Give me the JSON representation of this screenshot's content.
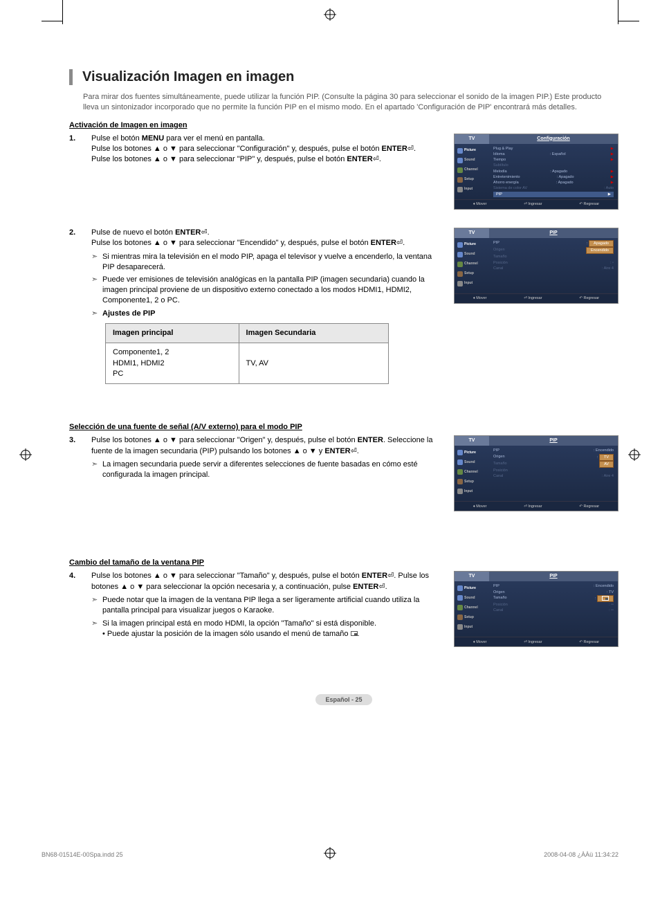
{
  "title": "Visualización Imagen en imagen",
  "intro": "Para mirar dos fuentes simultáneamente, puede utilizar la función PIP. (Consulte la página 30 para seleccionar el sonido de la imagen PIP.) Este producto lleva un sintonizador incorporado que no permite la función PIP en el mismo modo. En el apartado 'Configuración de PIP' encontrará más detalles.",
  "section1": {
    "heading": "Activación de Imagen en imagen",
    "step1a": "Pulse el botón ",
    "step1b": " para ver el menú en pantalla.",
    "menu": "MENU",
    "step1c": "Pulse los botones ▲ o ▼ para seleccionar \"Configuración\" y, después, pulse el botón ",
    "enter": "ENTER",
    "step1d": "Pulse los botones ▲ o ▼ para seleccionar \"PIP\" y, después, pulse el botón ",
    "step2a": "Pulse de nuevo el botón ",
    "step2b": "Pulse los botones ▲ o ▼ para seleccionar \"Encendido\" y, después, pulse el botón ",
    "note1": "Si mientras mira la televisión en el modo PIP, apaga el televisor y vuelve a encenderlo, la ventana PIP desaparecerá.",
    "note2": "Puede ver emisiones de televisión analógicas en la pantalla PIP (imagen secundaria) cuando la imagen principal proviene de un dispositivo externo conectado a los modos HDMI1, HDMI2, Componente1, 2 o PC.",
    "pip_settings": "Ajustes de PIP",
    "th1": "Imagen principal",
    "th2": "Imagen Secundaria",
    "td1a": "Componente1, 2",
    "td1b": "HDMI1, HDMI2",
    "td1c": "PC",
    "td2": "TV, AV"
  },
  "section2": {
    "heading": "Selección de una fuente de señal (A/V externo) para el modo PIP",
    "step3a": "Pulse los botones ▲ o ▼ para seleccionar \"Origen\" y, después, pulse el botón ",
    "step3b": ". Seleccione la fuente de la imagen secundaria (PIP) pulsando los botones ▲ o ▼ y ",
    "note": "La imagen secundaria puede servir a diferentes selecciones de fuente basadas en cómo esté configurada la imagen principal."
  },
  "section3": {
    "heading": "Cambio del tamaño de la ventana PIP",
    "step4a": "Pulse los botones ▲ o ▼ para seleccionar \"Tamaño\" y, después, pulse el botón ",
    "step4b": ". Pulse los botones ▲ o ▼ para seleccionar la opción necesaria y, a continuación, pulse ",
    "note1": "Puede notar que la imagen de la ventana PIP llega a ser ligeramente artificial cuando utiliza la pantalla principal para visualizar juegos o Karaoke.",
    "note2": "Si la imagen principal está en modo HDMI, la opción \"Tamaño\" si está disponible.",
    "note2b": "• Puede ajustar la posición de la imagen sólo usando el menú de tamaño "
  },
  "osd": {
    "tv": "TV",
    "side": {
      "picture": "Picture",
      "sound": "Sound",
      "channel": "Channel",
      "setup": "Setup",
      "input": "Input"
    },
    "footer": {
      "mover": "Mover",
      "ingresar": "Ingresar",
      "regresar": "Regresar"
    },
    "m1": {
      "title": "Configuración",
      "r1": "Plug & Play",
      "r2": "Idioma",
      "r2v": ": Español",
      "r3": "Tiempo",
      "r4": "Subtítulo",
      "r5": "Melodía",
      "r5v": ": Apagado",
      "r6": "Entretenimiento",
      "r6v": ": Apagado",
      "r7": "Ahorro energía",
      "r7v": ": Apagado",
      "r8": "Sistema de color AV",
      "r8v": ": Auto",
      "r9": "PIP"
    },
    "m2": {
      "title": "PIP",
      "r1": "PIP",
      "o1": "Apagado",
      "o2": "Encendido",
      "r2": "Origen",
      "r3": "Tamaño",
      "r4": "Posición",
      "r5": "Canal",
      "r5v": ": Aire    4"
    },
    "m3": {
      "title": "PIP",
      "r1": "PIP",
      "r1v": ": Encendido",
      "r2": "Origen",
      "o1": "TV",
      "o2": "AV",
      "r3": "Tamaño",
      "r4": "Posición",
      "r5": "Canal",
      "r5v": ": Aire  4"
    },
    "m4": {
      "title": "PIP",
      "r1": "PIP",
      "r1v": ": Encendido",
      "r2": "Origen",
      "r2v": ": TV",
      "r3": "Tamaño",
      "r4": "Posición",
      "r5": "Canal"
    }
  },
  "pagenum": "Español - 25",
  "docfile": "BN68-01514E-00Spa.indd   25",
  "doctime": "2008-04-08   ¿ÀÀü 11:34:22"
}
